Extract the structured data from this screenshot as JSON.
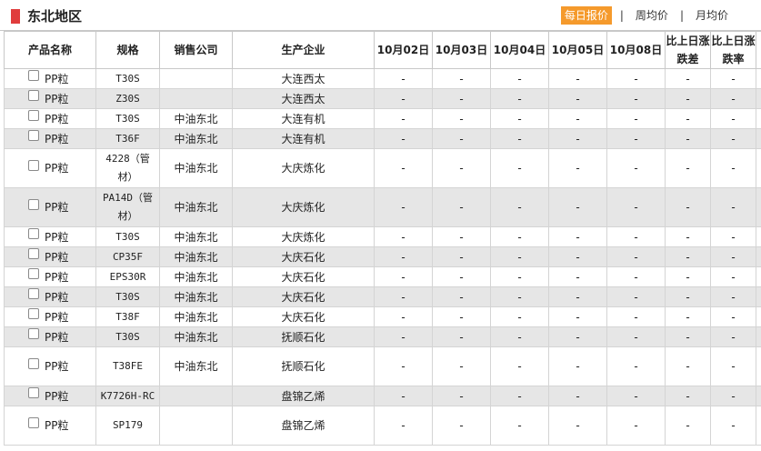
{
  "header": {
    "title": "东北地区",
    "tabs": [
      "每日报价",
      "周均价",
      "月均价"
    ],
    "separator": "|"
  },
  "table": {
    "columns": [
      "产品名称",
      "规格",
      "销售公司",
      "生产企业",
      "10月02日",
      "10月03日",
      "10月04日",
      "10月05日",
      "10月08日",
      "比上日涨跌差",
      "比上日涨跌率"
    ],
    "rows": [
      {
        "product": "PP粒",
        "spec": "T30S",
        "company": "",
        "producer": "大连西太",
        "v1": "-",
        "v2": "-",
        "v3": "-",
        "v4": "-",
        "v5": "-",
        "diff": "-",
        "rate": "-"
      },
      {
        "product": "PP粒",
        "spec": "Z30S",
        "company": "",
        "producer": "大连西太",
        "v1": "-",
        "v2": "-",
        "v3": "-",
        "v4": "-",
        "v5": "-",
        "diff": "-",
        "rate": "-"
      },
      {
        "product": "PP粒",
        "spec": "T30S",
        "company": "中油东北",
        "producer": "大连有机",
        "v1": "-",
        "v2": "-",
        "v3": "-",
        "v4": "-",
        "v5": "-",
        "diff": "-",
        "rate": "-"
      },
      {
        "product": "PP粒",
        "spec": "T36F",
        "company": "中油东北",
        "producer": "大连有机",
        "v1": "-",
        "v2": "-",
        "v3": "-",
        "v4": "-",
        "v5": "-",
        "diff": "-",
        "rate": "-"
      },
      {
        "product": "PP粒",
        "spec": "4228（管材）",
        "company": "中油东北",
        "producer": "大庆炼化",
        "v1": "-",
        "v2": "-",
        "v3": "-",
        "v4": "-",
        "v5": "-",
        "diff": "-",
        "rate": "-"
      },
      {
        "product": "PP粒",
        "spec": "PA14D（管材）",
        "company": "中油东北",
        "producer": "大庆炼化",
        "v1": "-",
        "v2": "-",
        "v3": "-",
        "v4": "-",
        "v5": "-",
        "diff": "-",
        "rate": "-"
      },
      {
        "product": "PP粒",
        "spec": "T30S",
        "company": "中油东北",
        "producer": "大庆炼化",
        "v1": "-",
        "v2": "-",
        "v3": "-",
        "v4": "-",
        "v5": "-",
        "diff": "-",
        "rate": "-"
      },
      {
        "product": "PP粒",
        "spec": "CP35F",
        "company": "中油东北",
        "producer": "大庆石化",
        "v1": "-",
        "v2": "-",
        "v3": "-",
        "v4": "-",
        "v5": "-",
        "diff": "-",
        "rate": "-"
      },
      {
        "product": "PP粒",
        "spec": "EPS30R",
        "company": "中油东北",
        "producer": "大庆石化",
        "v1": "-",
        "v2": "-",
        "v3": "-",
        "v4": "-",
        "v5": "-",
        "diff": "-",
        "rate": "-"
      },
      {
        "product": "PP粒",
        "spec": "T30S",
        "company": "中油东北",
        "producer": "大庆石化",
        "v1": "-",
        "v2": "-",
        "v3": "-",
        "v4": "-",
        "v5": "-",
        "diff": "-",
        "rate": "-"
      },
      {
        "product": "PP粒",
        "spec": "T38F",
        "company": "中油东北",
        "producer": "大庆石化",
        "v1": "-",
        "v2": "-",
        "v3": "-",
        "v4": "-",
        "v5": "-",
        "diff": "-",
        "rate": "-"
      },
      {
        "product": "PP粒",
        "spec": "T30S",
        "company": "中油东北",
        "producer": "抚顺石化",
        "v1": "-",
        "v2": "-",
        "v3": "-",
        "v4": "-",
        "v5": "-",
        "diff": "-",
        "rate": "-"
      },
      {
        "product": "PP粒",
        "spec": "T38FE",
        "company": "中油东北",
        "producer": "抚顺石化",
        "v1": "-",
        "v2": "-",
        "v3": "-",
        "v4": "-",
        "v5": "-",
        "diff": "-",
        "rate": "-"
      },
      {
        "product": "PP粒",
        "spec": "K7726H-RC",
        "company": "",
        "producer": "盘锦乙烯",
        "v1": "-",
        "v2": "-",
        "v3": "-",
        "v4": "-",
        "v5": "-",
        "diff": "-",
        "rate": "-"
      },
      {
        "product": "PP粒",
        "spec": "SP179",
        "company": "",
        "producer": "盘锦乙烯",
        "v1": "-",
        "v2": "-",
        "v3": "-",
        "v4": "-",
        "v5": "-",
        "diff": "-",
        "rate": "-"
      }
    ]
  }
}
